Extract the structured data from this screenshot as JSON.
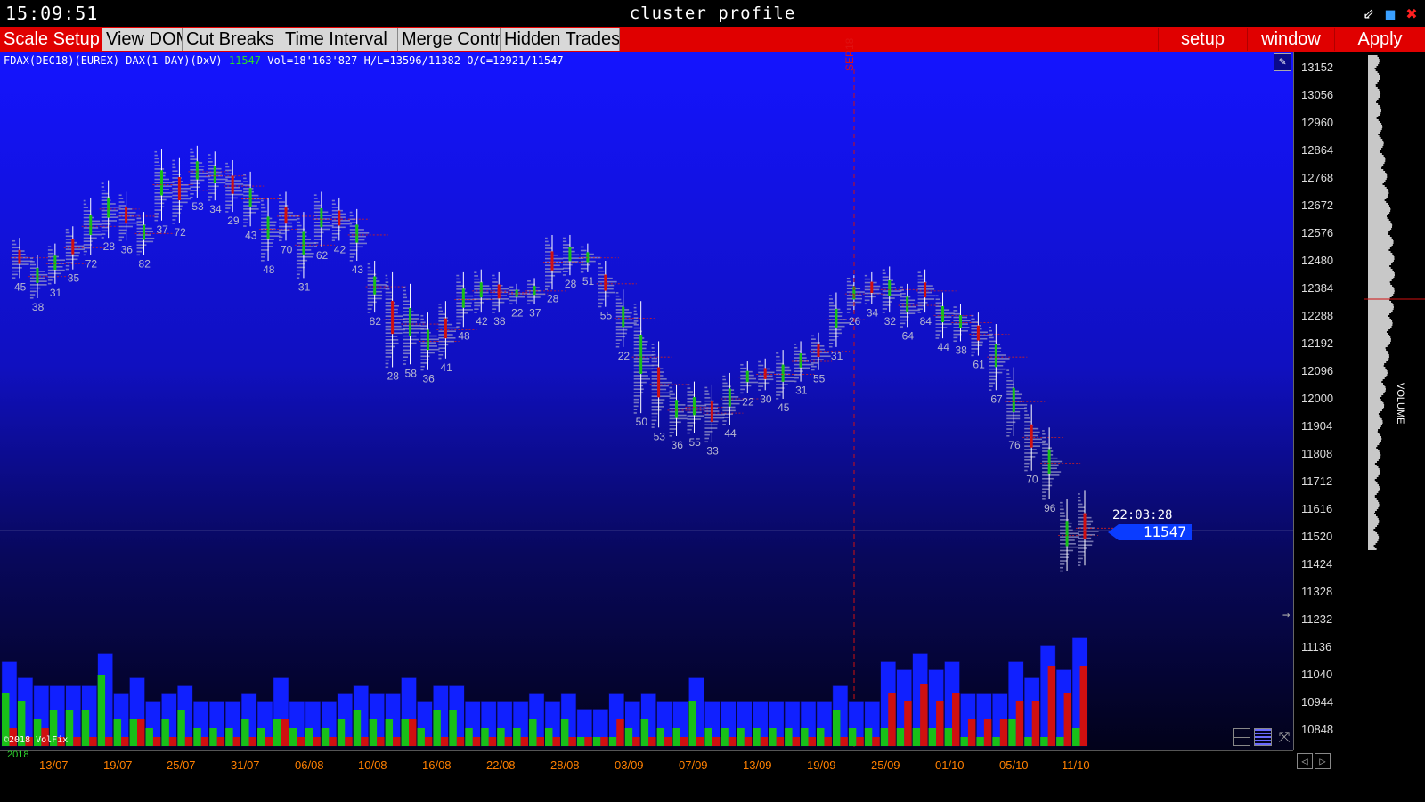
{
  "window": {
    "clock": "15:09:51",
    "title": "cluster profile"
  },
  "toolbar": {
    "items": [
      "Scale Setup",
      "View DOM",
      "Cut Breaks",
      "Time Interval",
      "Merge Contr",
      "Hidden Trades"
    ],
    "right": [
      "setup",
      "window",
      "Apply"
    ]
  },
  "info": {
    "symbol": "FDAX(DEC18)(EUREX) DAX(1 DAY)(DxV)",
    "last": "11547",
    "stats": "Vol=18'163'827 H/L=13596/11382 O/C=12921/11547"
  },
  "marker": {
    "label": "SEP18"
  },
  "last_time": "22:03:28",
  "last_price": "11547",
  "yaxis": {
    "ticks": [
      "13152",
      "13056",
      "12960",
      "12864",
      "12768",
      "12672",
      "12576",
      "12480",
      "12384",
      "12288",
      "12192",
      "12096",
      "12000",
      "11904",
      "11808",
      "11712",
      "11616",
      "11520",
      "11424",
      "11328",
      "11232",
      "11136",
      "11040",
      "10944",
      "10848"
    ]
  },
  "xaxis": {
    "year": "2018",
    "dates": [
      "13/07",
      "19/07",
      "25/07",
      "31/07",
      "06/08",
      "10/08",
      "16/08",
      "22/08",
      "28/08",
      "03/09",
      "07/09",
      "13/09",
      "19/09",
      "25/09",
      "01/10",
      "05/10",
      "11/10"
    ]
  },
  "copyright": "©2018 VolFix",
  "volume_panel_label": "VOLUME",
  "colors": {
    "up": "#18c018",
    "down": "#d01010",
    "neutral": "#1020ff",
    "profile": "#9a9ac8"
  },
  "chart_data": {
    "type": "bar",
    "title": "cluster profile",
    "xlabel": "",
    "ylabel": "",
    "ylim": [
      10848,
      13152
    ],
    "x_ticks": [
      "13/07",
      "19/07",
      "25/07",
      "31/07",
      "06/08",
      "10/08",
      "16/08",
      "22/08",
      "28/08",
      "03/09",
      "07/09",
      "13/09",
      "19/09",
      "25/09",
      "01/10",
      "05/10",
      "11/10"
    ],
    "profile_labels": [
      "45",
      "38",
      "31",
      "35",
      "72",
      "28",
      "36",
      "82",
      "37",
      "72",
      "53",
      "34",
      "29",
      "43",
      "48",
      "70",
      "31",
      "62",
      "42",
      "43",
      "82",
      "28",
      "58",
      "36",
      "41",
      "48",
      "42",
      "38",
      "22",
      "37",
      "28",
      "28",
      "51",
      "55",
      "22",
      "50",
      "53",
      "36",
      "55",
      "33",
      "44",
      "22",
      "30",
      "45",
      "31",
      "55",
      "31",
      "26",
      "34",
      "32",
      "64",
      "84",
      "44",
      "38",
      "61",
      "67",
      "76",
      "70",
      "96"
    ],
    "last_price": 11547,
    "volume_series": [
      {
        "name": "buy",
        "values": [
          6,
          5,
          3,
          4,
          4,
          4,
          8,
          3,
          3,
          2,
          3,
          4,
          2,
          2,
          2,
          3,
          2,
          3,
          2,
          2,
          2,
          3,
          4,
          3,
          3,
          3,
          2,
          4,
          4,
          2,
          2,
          2,
          2,
          3,
          2,
          3,
          1,
          1,
          1,
          2,
          3,
          2,
          2,
          5,
          2,
          2,
          2,
          2,
          2,
          2,
          2,
          2,
          4,
          2,
          2,
          2,
          2,
          2,
          2,
          2,
          1,
          1,
          1,
          3,
          1,
          1,
          1,
          2
        ]
      },
      {
        "name": "sell",
        "values": [
          2,
          1,
          2,
          1,
          1,
          1,
          1,
          1,
          3,
          1,
          1,
          1,
          1,
          1,
          1,
          1,
          1,
          3,
          1,
          1,
          1,
          1,
          1,
          1,
          1,
          3,
          1,
          1,
          1,
          1,
          1,
          1,
          1,
          1,
          1,
          1,
          1,
          1,
          3,
          1,
          1,
          1,
          1,
          1,
          1,
          1,
          1,
          1,
          1,
          1,
          1,
          1,
          1,
          1,
          1,
          6,
          5,
          7,
          5,
          6,
          3,
          3,
          3,
          5,
          5,
          9,
          6,
          9
        ]
      }
    ]
  }
}
